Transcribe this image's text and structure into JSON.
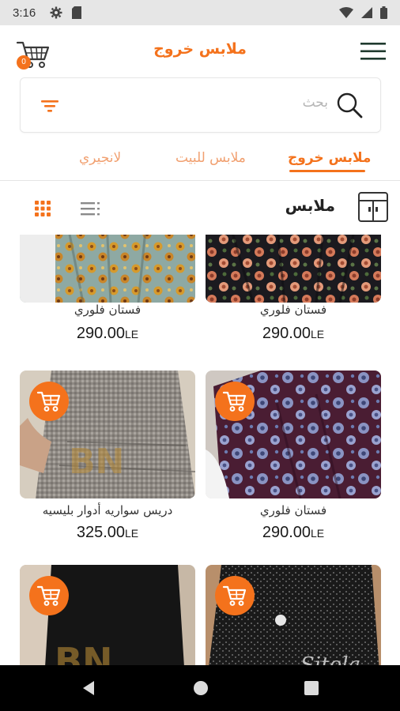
{
  "status_bar": {
    "time": "3:16",
    "icons": [
      "gear-icon",
      "sim-card-icon",
      "wifi-icon",
      "signal-icon",
      "battery-icon"
    ]
  },
  "app_bar": {
    "title": "ملابس خروج",
    "cart_count": "0",
    "brand_color": "#f4721c"
  },
  "search": {
    "placeholder": "بحث"
  },
  "tabs": [
    {
      "label": "ملابس خروج",
      "active": true
    },
    {
      "label": "ملابس للبيت",
      "active": false
    },
    {
      "label": "لانجيري",
      "active": false
    }
  ],
  "section": {
    "title": "ملابس"
  },
  "products": [
    {
      "name": "فستان فلوري",
      "price": "290.00",
      "currency": "LE"
    },
    {
      "name": "فستان فلوري",
      "price": "290.00",
      "currency": "LE"
    },
    {
      "name": "فستان فلوري",
      "price": "290.00",
      "currency": "LE"
    },
    {
      "name": "دريس سواريه أدوار بليسيه",
      "price": "325.00",
      "currency": "LE"
    },
    {
      "name": "",
      "price": "",
      "currency": ""
    },
    {
      "name": "",
      "price": "",
      "currency": ""
    }
  ]
}
